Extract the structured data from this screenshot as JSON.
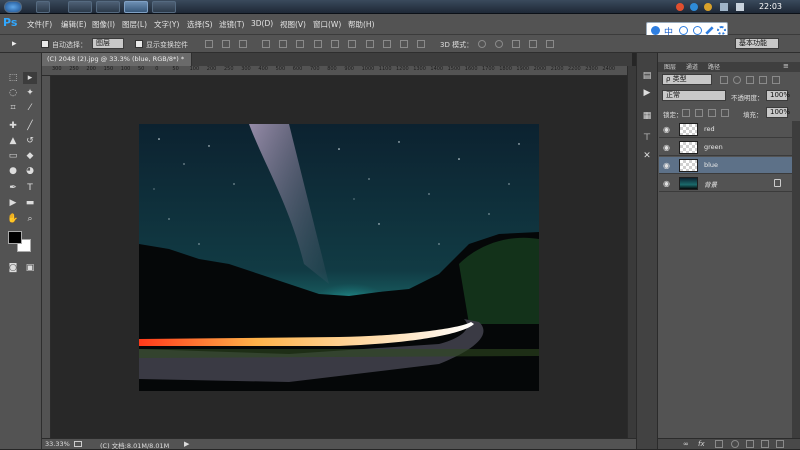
{
  "taskbar": {
    "clock": "22:03"
  },
  "menu": {
    "logo": "Ps",
    "items": [
      "文件(F)",
      "编辑(E)",
      "图像(I)",
      "图层(L)",
      "文字(Y)",
      "选择(S)",
      "滤镜(T)",
      "3D(D)",
      "视图(V)",
      "窗口(W)",
      "帮助(H)"
    ]
  },
  "options": {
    "auto_select_label": "自动选择：",
    "auto_select_value": "图层",
    "show_transform_label": "显示变换控件",
    "mode_3d_label": "3D 模式：",
    "workspace": "基本功能"
  },
  "ime": {
    "label": "中"
  },
  "document": {
    "tab_title": "(C) 2048 (2).jpg @ 33.3% (blue, RGB/8*) *",
    "ruler_ticks": [
      "300",
      "250",
      "200",
      "150",
      "100",
      "50",
      "0",
      "50",
      "100",
      "200",
      "250",
      "300",
      "400",
      "500",
      "600",
      "700",
      "800",
      "900",
      "1000",
      "1100",
      "1200",
      "1300",
      "1400",
      "1500",
      "1600",
      "1700",
      "1800",
      "1900",
      "2000",
      "2100",
      "2200",
      "2300",
      "2400"
    ]
  },
  "status": {
    "zoom": "33.33%",
    "doc_info": "(C) 文档:8.01M/8.01M"
  },
  "panel": {
    "tabs": [
      "图层",
      "通道",
      "路径"
    ],
    "filter_kind": "类型",
    "blend_mode": "正常",
    "opacity_label": "不透明度：",
    "opacity_value": "100%",
    "lock_label": "锁定：",
    "fill_label": "填充：",
    "fill_value": "100%",
    "layers": [
      {
        "name": "red",
        "selected": false
      },
      {
        "name": "green",
        "selected": false
      },
      {
        "name": "blue",
        "selected": true
      },
      {
        "name": "背景",
        "selected": false
      }
    ]
  },
  "colors": {
    "accent": "#31a8ff",
    "selection": "#5d7188",
    "ui_panel": "#535353"
  }
}
